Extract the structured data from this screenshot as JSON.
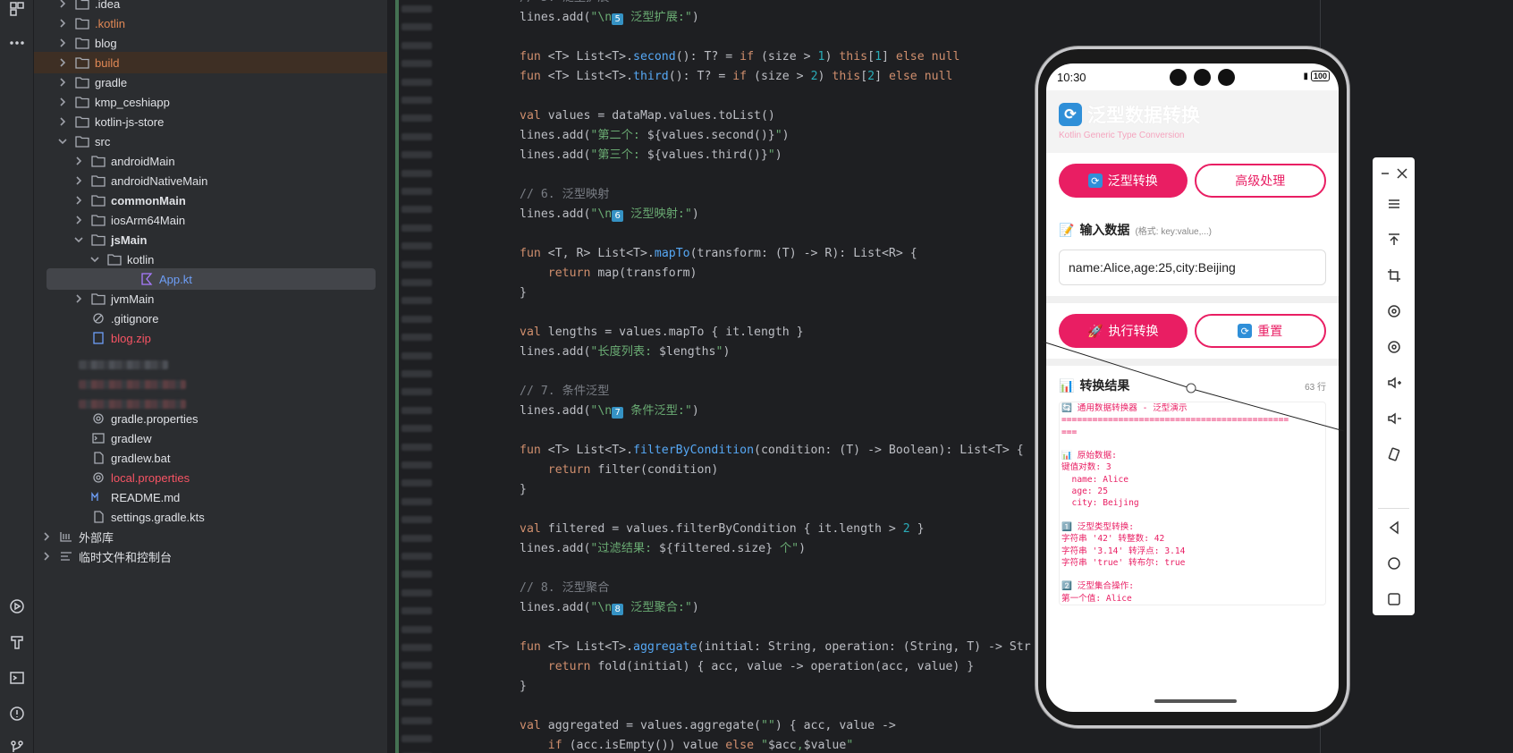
{
  "tree": {
    "rows": [
      {
        "label": ".idea",
        "style": ""
      },
      {
        "label": ".kotlin",
        "style": "orange"
      },
      {
        "label": "blog",
        "style": ""
      },
      {
        "label": "build",
        "style": "orange"
      },
      {
        "label": "gradle",
        "style": ""
      },
      {
        "label": "kmp_ceshiapp",
        "style": ""
      },
      {
        "label": "kotlin-js-store",
        "style": ""
      },
      {
        "label": "src",
        "style": ""
      },
      {
        "label": "androidMain",
        "style": ""
      },
      {
        "label": "androidNativeMain",
        "style": ""
      },
      {
        "label": "commonMain",
        "style": "bold"
      },
      {
        "label": "iosArm64Main",
        "style": ""
      },
      {
        "label": "jsMain",
        "style": "bold"
      },
      {
        "label": "kotlin",
        "style": ""
      },
      {
        "label": "App.kt",
        "style": "blue"
      },
      {
        "label": "jvmMain",
        "style": ""
      },
      {
        "label": ".gitignore",
        "style": ""
      },
      {
        "label": "blog.zip",
        "style": "red"
      },
      {
        "label": "gradle.properties",
        "style": ""
      },
      {
        "label": "gradlew",
        "style": ""
      },
      {
        "label": "gradlew.bat",
        "style": ""
      },
      {
        "label": "local.properties",
        "style": "red"
      },
      {
        "label": "README.md",
        "style": ""
      },
      {
        "label": "settings.gradle.kts",
        "style": ""
      },
      {
        "label": "外部库",
        "style": ""
      },
      {
        "label": "临时文件和控制台",
        "style": ""
      }
    ]
  },
  "editor": {
    "lines": [
      "lines.add(\"\\n5 泛型扩展:\")",
      "fun <T> List<T>.second(): T? = if (size > 1) this[1] else null",
      "fun <T> List<T>.third(): T? = if (size > 2) this[2] else null",
      "val values = dataMap.values.toList()",
      "lines.add(\"第二个: ${values.second()}\")",
      "lines.add(\"第三个: ${values.third()}\")",
      "// 6. 泛型映射",
      "lines.add(\"\\n6 泛型映射:\")",
      "fun <T, R> List<T>.mapTo(transform: (T) -> R): List<R> {",
      "    return map(transform)",
      "}",
      "val lengths = values.mapTo { it.length }",
      "lines.add(\"长度列表: $lengths\")",
      "// 7. 条件泛型",
      "lines.add(\"\\n7 条件泛型:\")",
      "fun <T> List<T>.filterByCondition(condition: (T) -> Boolean): List<T> {",
      "    return filter(condition)",
      "}",
      "val filtered = values.filterByCondition { it.length > 2 }",
      "lines.add(\"过滤结果: ${filtered.size} 个\")",
      "// 8. 泛型聚合",
      "lines.add(\"\\n8 泛型聚合:\")",
      "fun <T> List<T>.aggregate(initial: String, operation: (String, T) -> Str",
      "    return fold(initial) { acc, value -> operation(acc, value) }",
      "}",
      "val aggregated = values.aggregate(\"\") { acc, value ->",
      "    if (acc.isEmpty()) value else \"$acc,$value\""
    ]
  },
  "phone": {
    "time": "10:30",
    "battery": "100",
    "app_title": "泛型数据转换",
    "app_subtitle": "Kotlin Generic Type Conversion",
    "tab_generic": "泛型转换",
    "tab_advanced": "高级处理",
    "input_label": "输入数据",
    "input_hint": "(格式: key:value,...)",
    "input_value": "name:Alice,age:25,city:Beijing",
    "run_button": "执行转换",
    "reset_button": "重置",
    "result_title": "转换结果",
    "result_count": "63 行",
    "result_lines": [
      "🔄 通用数据转换器 - 泛型演示",
      "============================================",
      "===",
      "",
      "📊 原始数据:",
      "键值对数: 3",
      "  name: Alice",
      "  age: 25",
      "  city: Beijing",
      "",
      "1️⃣ 泛型类型转换:",
      "字符串 '42' 转整数: 42",
      "字符串 '3.14' 转浮点: 3.14",
      "字符串 'true' 转布尔: true",
      "",
      "2️⃣ 泛型集合操作:",
      "第一个值: Alice"
    ]
  }
}
